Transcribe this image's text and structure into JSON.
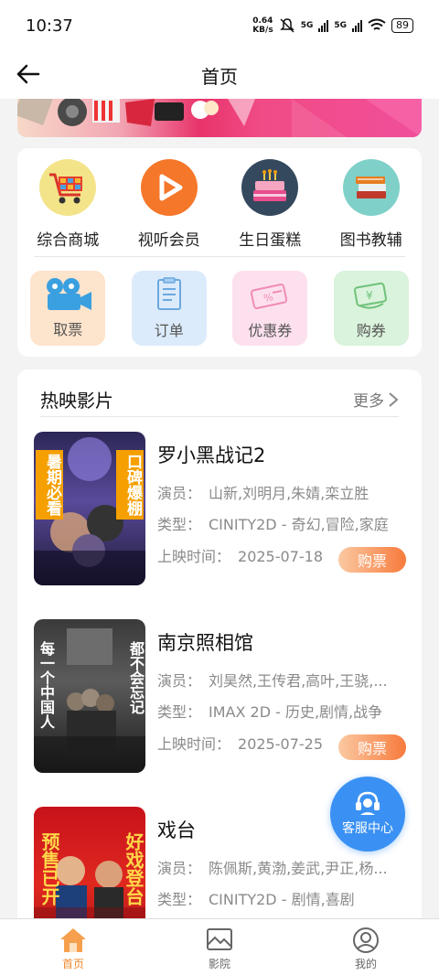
{
  "status": {
    "time": "10:37",
    "net_speed": "0.64",
    "net_unit": "KB/s",
    "sig1": "5G",
    "sig2": "5G",
    "battery": "89"
  },
  "nav": {
    "title": "首页"
  },
  "categories": [
    {
      "label": "综合商城",
      "icon": "cart-icon"
    },
    {
      "label": "视听会员",
      "icon": "play-icon"
    },
    {
      "label": "生日蛋糕",
      "icon": "cake-icon"
    },
    {
      "label": "图书教辅",
      "icon": "books-icon"
    }
  ],
  "tiles": [
    {
      "label": "取票",
      "icon": "camera-icon"
    },
    {
      "label": "订单",
      "icon": "document-icon"
    },
    {
      "label": "优惠券",
      "icon": "coupon-icon"
    },
    {
      "label": "购券",
      "icon": "voucher-icon"
    }
  ],
  "section": {
    "title": "热映影片",
    "more": "更多"
  },
  "movie_labels": {
    "actors": "演员：",
    "genre": "类型：",
    "release": "上映时间：",
    "buy": "购票"
  },
  "movies": [
    {
      "title": "罗小黑战记2",
      "actors": "山新,刘明月,朱婧,栾立胜",
      "genre": "CINITY2D - 奇幻,冒险,家庭",
      "release": "2025-07-18",
      "poster_left": "暑期必看",
      "poster_right": "口碑爆棚"
    },
    {
      "title": "南京照相馆",
      "actors": "刘昊然,王传君,高叶,王骁,...",
      "genre": "IMAX 2D - 历史,剧情,战争",
      "release": "2025-07-25",
      "poster_left": "每一个中国人",
      "poster_right": "都不会忘记"
    },
    {
      "title": "戏台",
      "actors": "陈佩斯,黄渤,姜武,尹正,杨...",
      "genre": "CINITY2D - 剧情,喜剧",
      "release": "",
      "poster_left": "预售已开",
      "poster_right": "好戏登台"
    }
  ],
  "service": {
    "label": "客服中心"
  },
  "tabbar": [
    {
      "label": "首页",
      "active": true
    },
    {
      "label": "影院",
      "active": false
    },
    {
      "label": "我的",
      "active": false
    }
  ],
  "colors": {
    "accent": "#f28a2e",
    "service": "#3a91f3"
  }
}
